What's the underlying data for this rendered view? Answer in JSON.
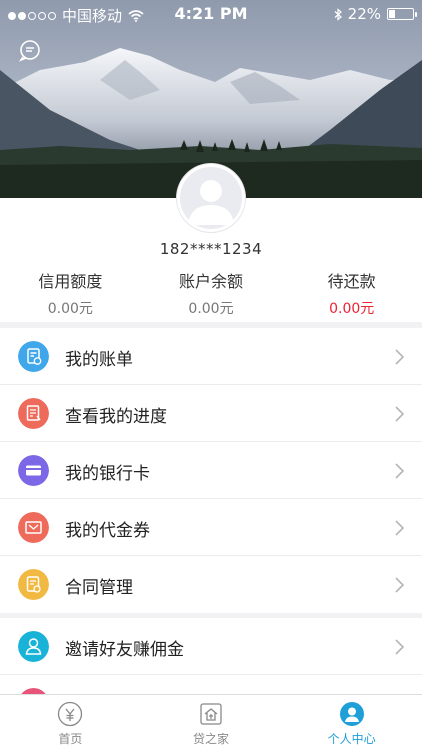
{
  "status_bar": {
    "carrier": "中国移动",
    "time": "4:21 PM",
    "battery": "22%",
    "battery_level": 0.22
  },
  "profile": {
    "phone": "182****1234",
    "stats": [
      {
        "label": "信用额度",
        "value": "0.00元"
      },
      {
        "label": "账户余额",
        "value": "0.00元"
      },
      {
        "label": "待还款",
        "value": "0.00元"
      }
    ]
  },
  "menu_primary": [
    {
      "label": "我的账单",
      "icon": "bill-icon",
      "color": "#3fa7ea"
    },
    {
      "label": "查看我的进度",
      "icon": "progress-icon",
      "color": "#ee6a5a"
    },
    {
      "label": "我的银行卡",
      "icon": "bank-card-icon",
      "color": "#7c67e6"
    },
    {
      "label": "我的代金券",
      "icon": "voucher-icon",
      "color": "#ee6a5a"
    },
    {
      "label": "合同管理",
      "icon": "contract-icon",
      "color": "#f1b942"
    }
  ],
  "menu_secondary": [
    {
      "label": "邀请好友赚佣金",
      "icon": "invite-icon",
      "color": "#1ab3d8"
    }
  ],
  "tabs": [
    {
      "label": "首页",
      "icon": "home-yen-icon"
    },
    {
      "label": "贷之家",
      "icon": "loan-home-icon"
    },
    {
      "label": "个人中心",
      "icon": "user-center-icon"
    }
  ],
  "colors": {
    "accent": "#1e9fd8",
    "danger": "#ee2233"
  }
}
